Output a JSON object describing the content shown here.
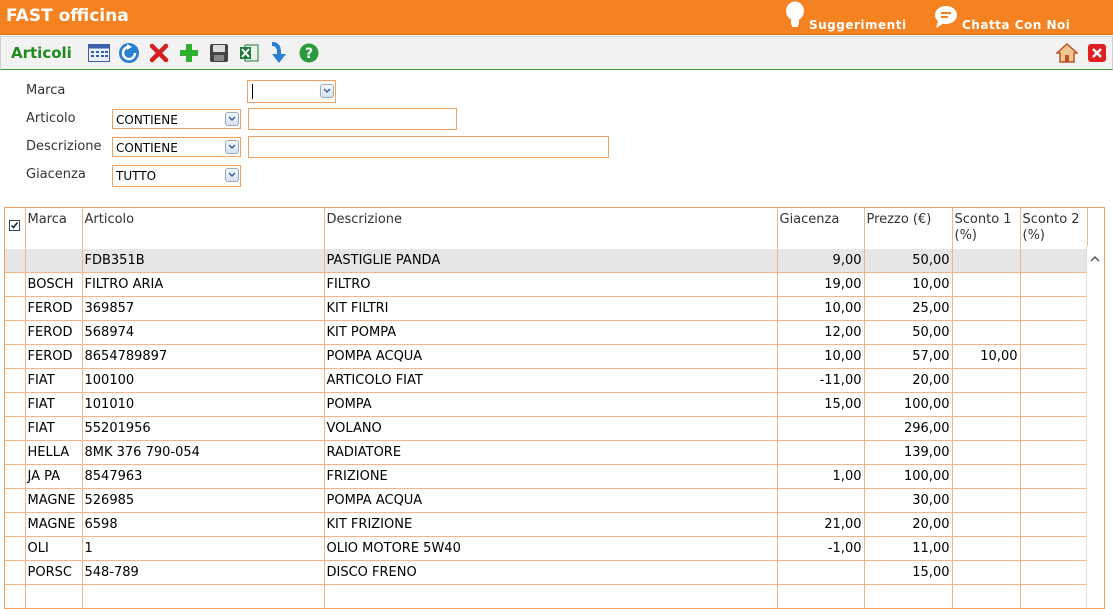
{
  "app": {
    "title": "FAST officina",
    "links": {
      "suggestions": "Suggerimenti",
      "chat": "Chatta Con Noi"
    }
  },
  "toolbar": {
    "title": "Articoli",
    "icons": [
      "grid-view-icon",
      "refresh-icon",
      "delete-icon",
      "add-icon",
      "save-icon",
      "excel-export-icon",
      "download-arrow-icon",
      "help-icon"
    ],
    "right_icons": [
      "home-icon",
      "close-icon"
    ]
  },
  "filters": {
    "marca": {
      "label": "Marca",
      "value": ""
    },
    "articolo": {
      "label": "Articolo",
      "operator": "CONTIENE",
      "value": ""
    },
    "descrizione": {
      "label": "Descrizione",
      "operator": "CONTIENE",
      "value": ""
    },
    "giacenza": {
      "label": "Giacenza",
      "value": "TUTTO"
    }
  },
  "grid": {
    "columns": [
      "Marca",
      "Articolo",
      "Descrizione",
      "Giacenza",
      "Prezzo (€)",
      "Sconto 1 (%)",
      "Sconto 2 (%)"
    ],
    "rows": [
      {
        "marca": "",
        "articolo": "FDB351B",
        "descrizione": "PASTIGLIE PANDA",
        "giacenza": "9,00",
        "prezzo": "50,00",
        "sconto1": "",
        "sconto2": ""
      },
      {
        "marca": "BOSCH",
        "articolo": "FILTRO ARIA",
        "descrizione": "FILTRO",
        "giacenza": "19,00",
        "prezzo": "10,00",
        "sconto1": "",
        "sconto2": ""
      },
      {
        "marca": "FEROD",
        "articolo": "369857",
        "descrizione": "KIT FILTRI",
        "giacenza": "10,00",
        "prezzo": "25,00",
        "sconto1": "",
        "sconto2": ""
      },
      {
        "marca": "FEROD",
        "articolo": "568974",
        "descrizione": "KIT POMPA",
        "giacenza": "12,00",
        "prezzo": "50,00",
        "sconto1": "",
        "sconto2": ""
      },
      {
        "marca": "FEROD",
        "articolo": "8654789897",
        "descrizione": "POMPA ACQUA",
        "giacenza": "10,00",
        "prezzo": "57,00",
        "sconto1": "10,00",
        "sconto2": ""
      },
      {
        "marca": "FIAT",
        "articolo": "100100",
        "descrizione": "ARTICOLO FIAT",
        "giacenza": "-11,00",
        "prezzo": "20,00",
        "sconto1": "",
        "sconto2": ""
      },
      {
        "marca": "FIAT",
        "articolo": "101010",
        "descrizione": "POMPA",
        "giacenza": "15,00",
        "prezzo": "100,00",
        "sconto1": "",
        "sconto2": ""
      },
      {
        "marca": "FIAT",
        "articolo": "55201956",
        "descrizione": "VOLANO",
        "giacenza": "",
        "prezzo": "296,00",
        "sconto1": "",
        "sconto2": ""
      },
      {
        "marca": "HELLA",
        "articolo": "8MK 376 790-054",
        "descrizione": "RADIATORE",
        "giacenza": "",
        "prezzo": "139,00",
        "sconto1": "",
        "sconto2": ""
      },
      {
        "marca": "JA PA",
        "articolo": "8547963",
        "descrizione": "FRIZIONE",
        "giacenza": "1,00",
        "prezzo": "100,00",
        "sconto1": "",
        "sconto2": ""
      },
      {
        "marca": "MAGNE",
        "articolo": "526985",
        "descrizione": "POMPA ACQUA",
        "giacenza": "",
        "prezzo": "30,00",
        "sconto1": "",
        "sconto2": ""
      },
      {
        "marca": "MAGNE",
        "articolo": "6598",
        "descrizione": "KIT FRIZIONE",
        "giacenza": "21,00",
        "prezzo": "20,00",
        "sconto1": "",
        "sconto2": ""
      },
      {
        "marca": "OLI",
        "articolo": "1",
        "descrizione": "OLIO MOTORE 5W40",
        "giacenza": "-1,00",
        "prezzo": "11,00",
        "sconto1": "",
        "sconto2": ""
      },
      {
        "marca": "PORSC",
        "articolo": "548-789",
        "descrizione": "DISCO FRENO",
        "giacenza": "",
        "prezzo": "15,00",
        "sconto1": "",
        "sconto2": ""
      },
      {
        "marca": "",
        "articolo": "",
        "descrizione": "",
        "giacenza": "",
        "prezzo": "",
        "sconto1": "",
        "sconto2": ""
      }
    ]
  },
  "colors": {
    "brand": "#f58220",
    "section": "#1f8a1f",
    "border": "#f0a060"
  }
}
